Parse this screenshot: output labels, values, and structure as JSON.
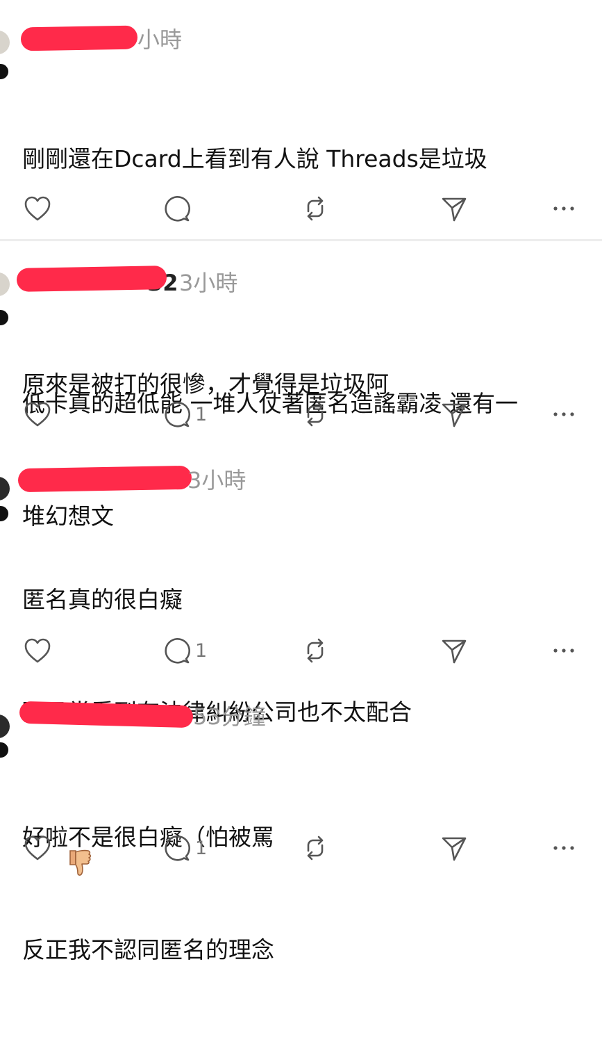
{
  "posts": [
    {
      "time": "小時",
      "name_fragment": "",
      "lines": [
        "剛剛還在Dcard上看到有人說 Threads是垃圾",
        "",
        "原來是被打的很慘，才覺得是垃圾阿"
      ],
      "reply_count": ""
    },
    {
      "time": "3小時",
      "name_fragment": "32",
      "lines": [
        "低卡真的超低能 一堆人仗著匿名造謠霸凌 還有一",
        "堆幻想文"
      ],
      "reply_count": "1"
    },
    {
      "time": "3小時",
      "name_fragment": "",
      "lines": [
        "匿名真的很白癡",
        "而且常看到有法律糾紛公司也不太配合"
      ],
      "emoji": "thumbs-down",
      "reply_count": "1"
    },
    {
      "time": "53分鐘",
      "name_fragment": "",
      "lines": [
        "好啦不是很白癡（怕被罵",
        "反正我不認同匿名的理念"
      ],
      "reply_count": "1"
    }
  ],
  "colors": {
    "redaction": "#ff2a4a",
    "icon": "#555555",
    "muted_text": "#999999"
  },
  "icons": [
    "heart-icon",
    "comment-icon",
    "repost-icon",
    "share-icon",
    "more-icon"
  ]
}
